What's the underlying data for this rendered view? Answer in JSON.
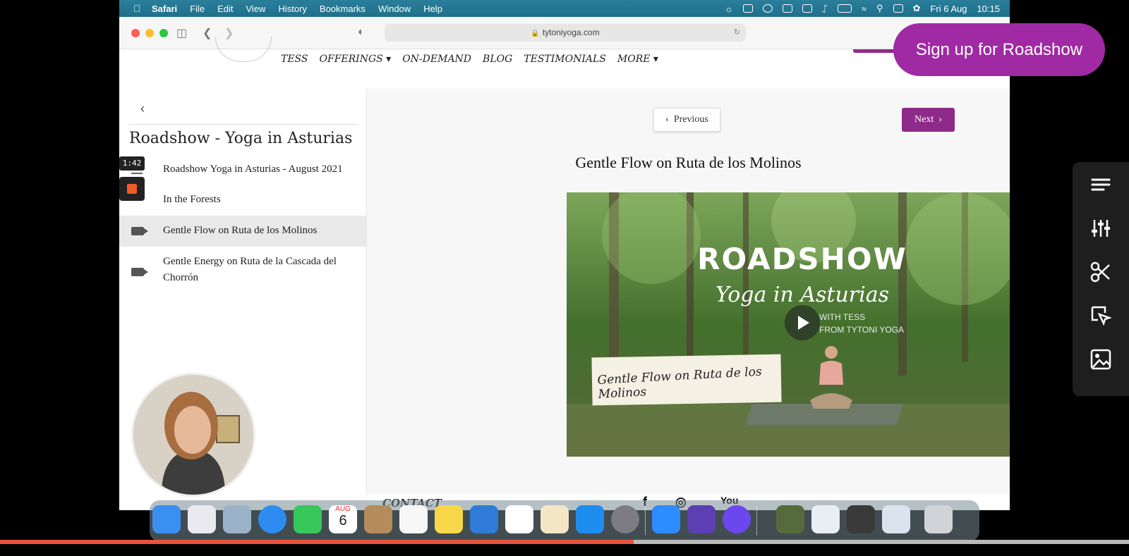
{
  "menubar": {
    "app": "Safari",
    "items": [
      "File",
      "Edit",
      "View",
      "History",
      "Bookmarks",
      "Window",
      "Help"
    ],
    "date": "Fri 6 Aug",
    "time": "10:15"
  },
  "browser": {
    "url": "tytoniyoga.com"
  },
  "site_nav": {
    "links": [
      "TESS",
      "OFFERINGS ▾",
      "ON-DEMAND",
      "BLOG",
      "TESTIMONIALS",
      "MORE ▾"
    ]
  },
  "course": {
    "title": "Roadshow - Yoga in Asturias",
    "lessons": [
      {
        "label": "Roadshow Yoga in Asturias - August 2021",
        "icon": "list-icon"
      },
      {
        "label": "In the Forests",
        "icon": "stop-icon"
      },
      {
        "label": "Gentle Flow on Ruta de los Molinos",
        "icon": "video-camera-icon",
        "active": true
      },
      {
        "label": "Gentle Energy on Ruta de la Cascada del Chorrón",
        "icon": "video-camera-icon"
      }
    ]
  },
  "recording": {
    "timer": "1:42"
  },
  "lesson_view": {
    "prev_label": "Previous",
    "next_label": "Next",
    "heading": "Gentle Flow on Ruta de los Molinos",
    "video": {
      "title": "ROADSHOW",
      "subtitle": "Yoga in Asturias",
      "with_line1": "WITH TESS",
      "with_line2": "FROM TYTONI YOGA",
      "caption": "Gentle Flow on Ruta de los Molinos"
    }
  },
  "footer": {
    "contact": "CONTACT",
    "social": [
      "f",
      "◎",
      "You"
    ]
  },
  "overlay": {
    "signup_label": "Sign up for Roadshow"
  },
  "dock": {
    "calendar_month": "AUG",
    "calendar_day": "6"
  },
  "colors": {
    "brand_purple": "#8e2b8a",
    "signup_purple": "#a02aa3",
    "progress": "#e8533d"
  },
  "video_progress": 0.561
}
